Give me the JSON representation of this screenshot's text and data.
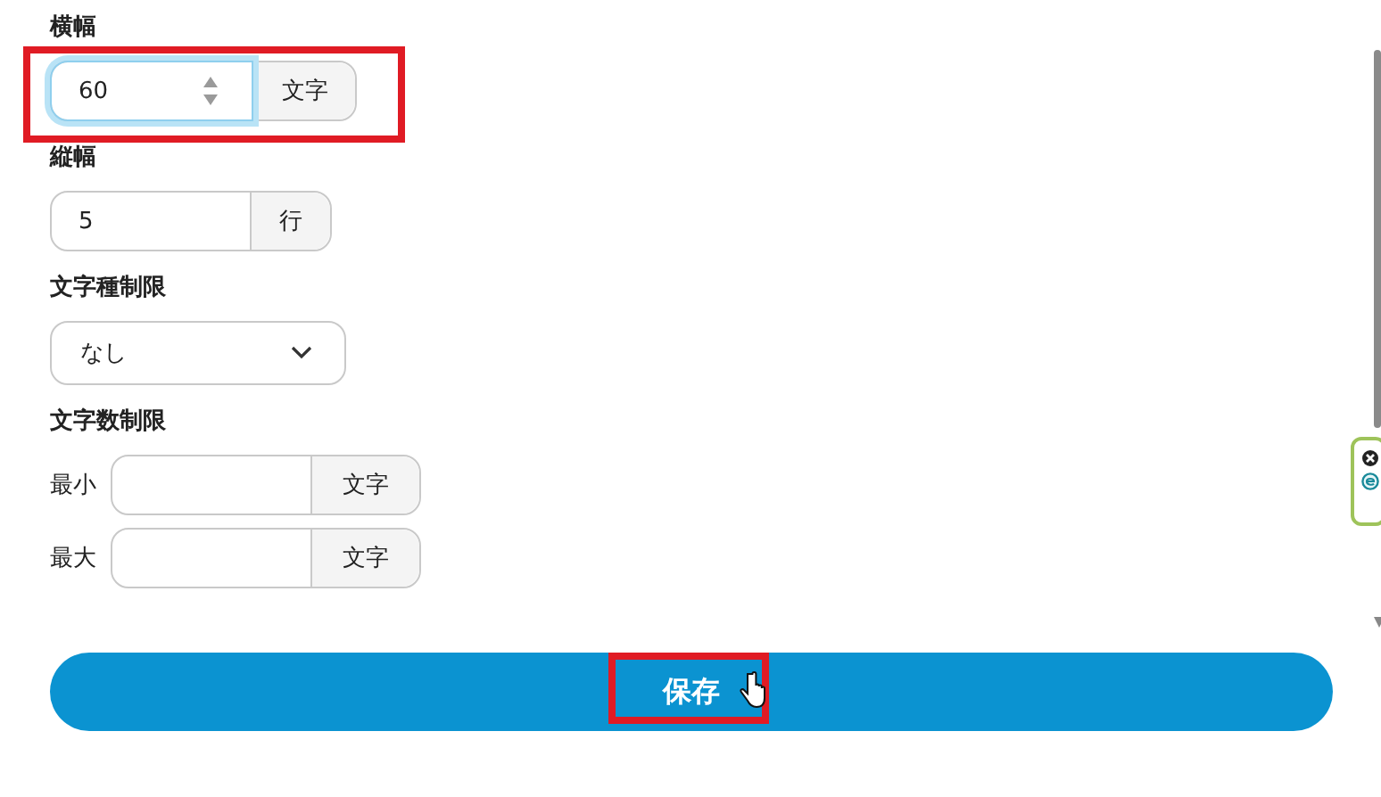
{
  "fields": [
    {
      "kind": "unit",
      "label": "横幅",
      "value": "60",
      "unit": "文字",
      "focused": true
    },
    {
      "kind": "unit",
      "label": "縦幅",
      "value": "5",
      "unit": "行",
      "focused": false
    },
    {
      "kind": "select",
      "label": "文字種制限",
      "value": "なし"
    },
    {
      "kind": "range",
      "label": "文字数制限",
      "rows": [
        {
          "label": "最小",
          "unit": "文字"
        },
        {
          "label": "最大",
          "unit": "文字"
        }
      ]
    }
  ],
  "save_button": {
    "label": "保存"
  }
}
